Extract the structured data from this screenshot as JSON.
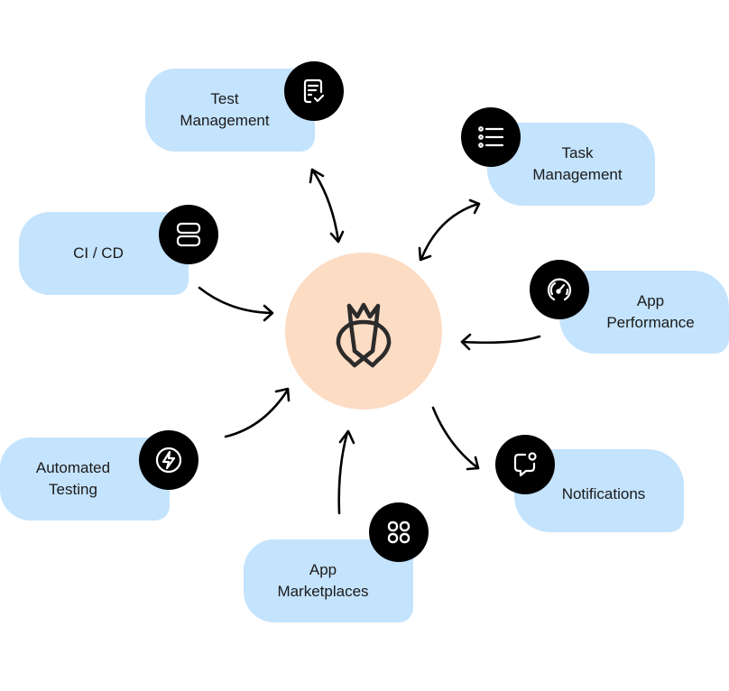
{
  "diagram": {
    "hub": {
      "icon": "crown-shield-logo-icon",
      "color": "#fddcc4"
    },
    "pill_color": "#c4e3fd",
    "badge_color": "#000000",
    "nodes": [
      {
        "id": "test-management",
        "label": "Test\nManagement",
        "icon": "clipboard-check-icon",
        "arrow": "bidirectional"
      },
      {
        "id": "task-management",
        "label": "Task\nManagement",
        "icon": "list-icon",
        "arrow": "bidirectional"
      },
      {
        "id": "ci-cd",
        "label": "CI / CD",
        "icon": "server-stack-icon",
        "arrow": "to-hub"
      },
      {
        "id": "app-performance",
        "label": "App\nPerformance",
        "icon": "speedometer-icon",
        "arrow": "to-hub"
      },
      {
        "id": "automated-testing",
        "label": "Automated\nTesting",
        "icon": "lightning-bolt-icon",
        "arrow": "to-hub"
      },
      {
        "id": "app-marketplaces",
        "label": "App\nMarketplaces",
        "icon": "app-grid-icon",
        "arrow": "to-hub"
      },
      {
        "id": "notifications",
        "label": "Notifications",
        "icon": "chat-notification-icon",
        "arrow": "from-hub"
      }
    ]
  }
}
